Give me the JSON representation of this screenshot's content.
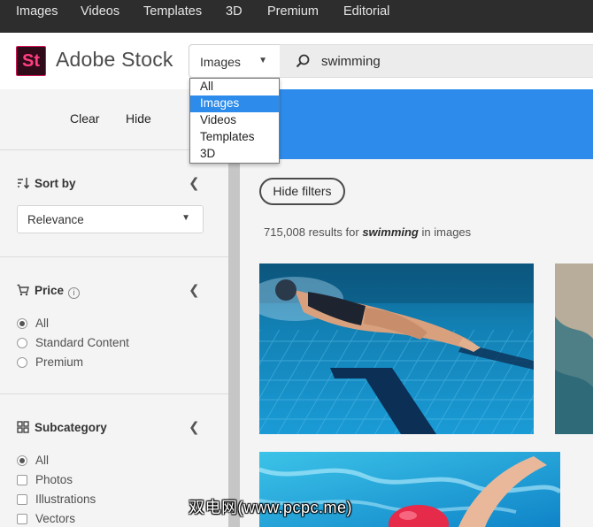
{
  "topnav": {
    "items": [
      "Images",
      "Videos",
      "Templates",
      "3D",
      "Premium",
      "Editorial"
    ]
  },
  "header": {
    "logo_mark": "St",
    "logo_text": "Adobe Stock",
    "type_select": "Images",
    "search_query": "swimming"
  },
  "dropdown": {
    "options": [
      "All",
      "Images",
      "Videos",
      "Templates",
      "3D"
    ],
    "selected": "Images"
  },
  "sidebar": {
    "clear_label": "Clear",
    "hide_label": "Hide",
    "sort": {
      "title": "Sort by",
      "value": "Relevance"
    },
    "price": {
      "title": "Price",
      "options": [
        "All",
        "Standard Content",
        "Premium"
      ],
      "selected": "All"
    },
    "subcategory": {
      "title": "Subcategory",
      "options": [
        "All",
        "Photos",
        "Illustrations",
        "Vectors"
      ],
      "selected": "All"
    }
  },
  "main": {
    "hide_filters_label": "Hide filters",
    "results_count": "715,008 results for",
    "results_query": "swimming",
    "results_scope": "in images"
  },
  "watermark": "双电网(www.pcpc.me)",
  "colors": {
    "accent_blue": "#2d8ceb",
    "nav_bg": "#2d2d2d",
    "logo_pink": "#ff3f7f"
  }
}
